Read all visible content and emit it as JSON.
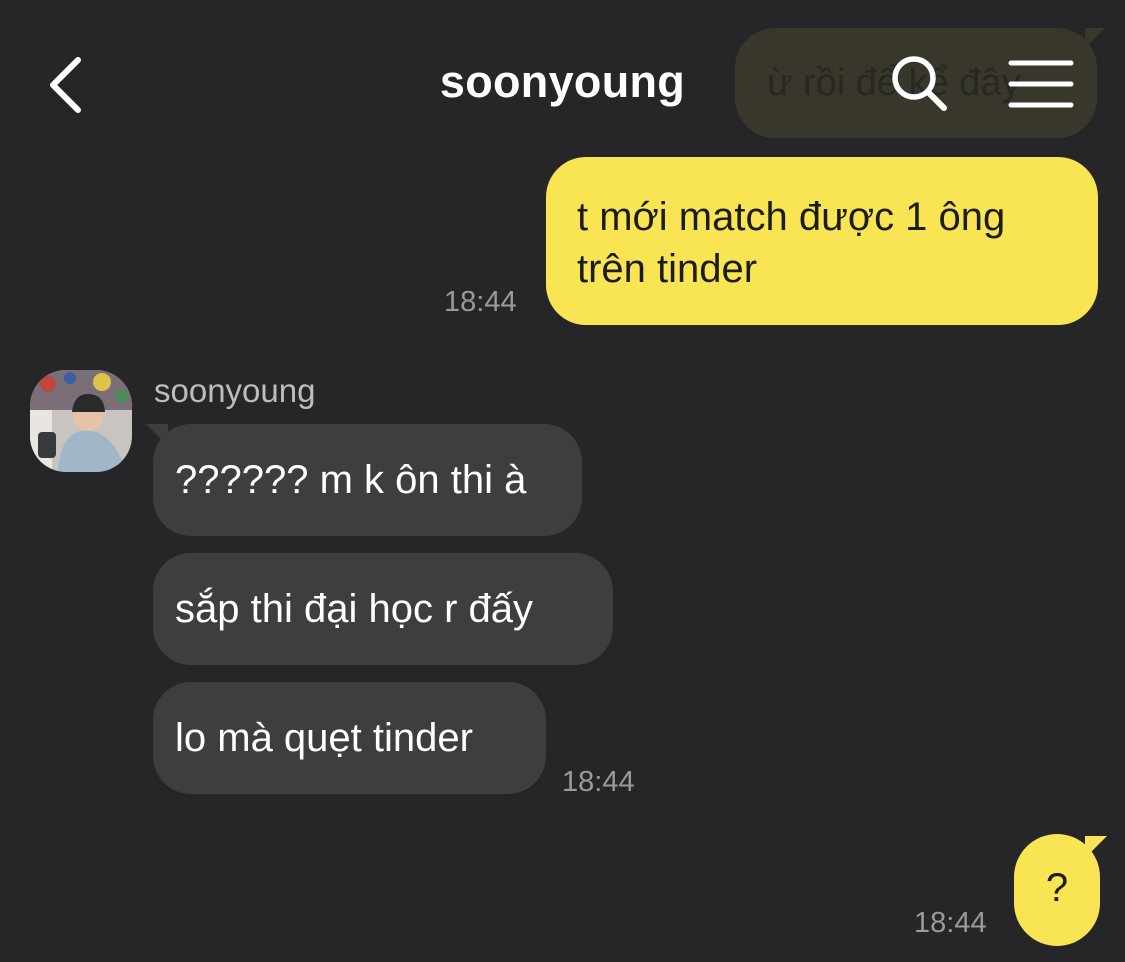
{
  "header": {
    "title": "soonyoung",
    "back_icon": "chevron-left-icon",
    "search_icon": "search-icon",
    "menu_icon": "menu-icon"
  },
  "faded_message": {
    "text": "ừ rồi để kể đây"
  },
  "messages": {
    "outgoing_1": {
      "line1": "t mới match được 1 ông",
      "line2": "trên tinder",
      "time": "18:44"
    },
    "incoming": {
      "sender": "soonyoung",
      "bubbles": [
        "?????? m k ôn thi à",
        "sắp thi đại học r đấy",
        "lo mà quẹt tinder"
      ],
      "time": "18:44"
    },
    "outgoing_2": {
      "text": "?",
      "time": "18:44"
    }
  },
  "colors": {
    "background": "#262628",
    "outgoing_bubble": "#f9e553",
    "incoming_bubble": "#3e3e41",
    "timestamp": "#9a9a9c"
  }
}
